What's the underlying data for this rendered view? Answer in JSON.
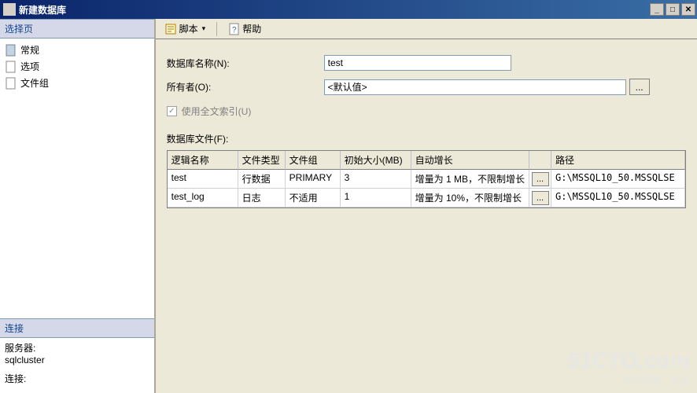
{
  "window": {
    "title": "新建数据库",
    "min": "_",
    "max": "□",
    "close": "✕"
  },
  "toolbar": {
    "script_label": "脚本",
    "dropdown_glyph": "▾",
    "help_label": "帮助"
  },
  "left": {
    "select_header": "选择页",
    "nav": {
      "general": "常规",
      "options": "选项",
      "filegroups": "文件组"
    },
    "conn_header": "连接",
    "server_label": "服务器:",
    "server_value": "sqlcluster",
    "conn_label": "连接:"
  },
  "form": {
    "dbname_label": "数据库名称(N):",
    "dbname_value": "test",
    "owner_label": "所有者(O):",
    "owner_value": "<默认值>",
    "ellipsis": "...",
    "fulltext_label": "使用全文索引(U)",
    "fulltext_check": "✓",
    "files_label": "数据库文件(F):"
  },
  "grid": {
    "headers": {
      "logical": "逻辑名称",
      "type": "文件类型",
      "fg": "文件组",
      "size": "初始大小(MB)",
      "auto": "自动增长",
      "path": "路径"
    },
    "rows": [
      {
        "logical": "test",
        "type": "行数据",
        "fg": "PRIMARY",
        "size": "3",
        "auto": "增量为 1 MB，不限制增长",
        "path": "G:\\MSSQL10_50.MSSQLSE"
      },
      {
        "logical": "test_log",
        "type": "日志",
        "fg": "不适用",
        "size": "1",
        "auto": "增量为 10%，不限制增长",
        "path": "G:\\MSSQL10_50.MSSQLSE"
      }
    ],
    "ellipsis": "..."
  },
  "watermark": {
    "big": "51CTO.com",
    "small": "技术博客　Blog"
  }
}
